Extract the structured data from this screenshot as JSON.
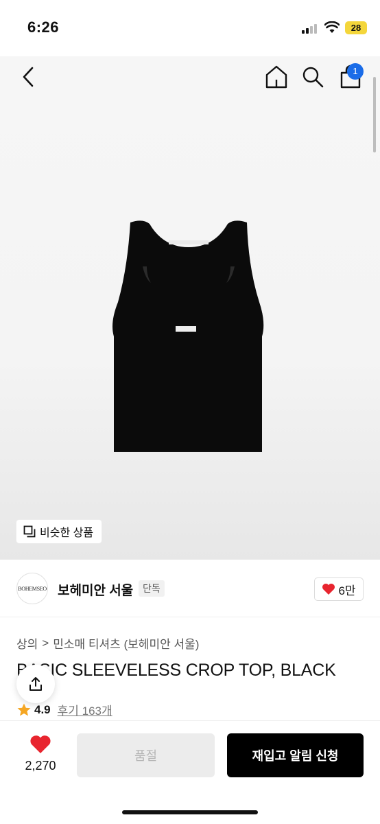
{
  "status_bar": {
    "time": "6:26",
    "battery": "28"
  },
  "nav": {
    "cart_count": "1"
  },
  "similar": {
    "label": "비슷한 상품"
  },
  "brand": {
    "logo_text": "BOHEMSEO",
    "name": "보헤미안 서울",
    "tag": "단독",
    "likes": "6만"
  },
  "breadcrumb": {
    "category": "상의",
    "separator": ">",
    "subcategory": "민소매 티셔츠 (보헤미안 서울)"
  },
  "product": {
    "title": "BASIC SLEEVELESS CROP TOP, BLACK",
    "rating": "4.9",
    "reviews": "후기 163개"
  },
  "bottom": {
    "wish_count": "2,270",
    "soldout_label": "품절",
    "restock_label": "재입고 알림 신청"
  },
  "colors": {
    "accent": "#1a6ce8",
    "heart": "#e8252f",
    "star": "#f5a623",
    "primary_btn": "#000000"
  }
}
